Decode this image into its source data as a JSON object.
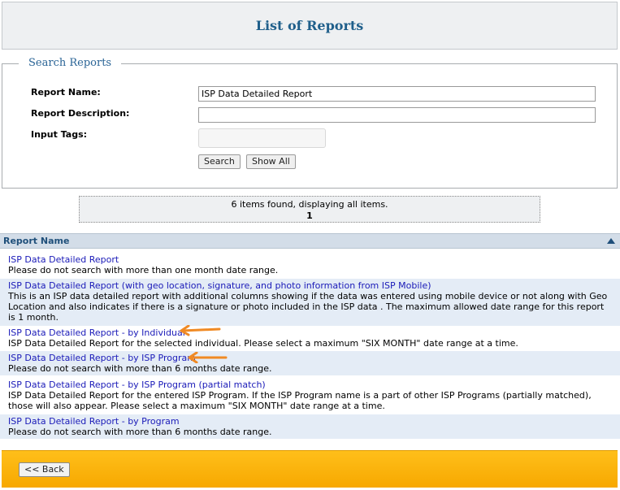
{
  "header": {
    "title": "List of Reports"
  },
  "search": {
    "legend": "Search Reports",
    "report_name_label": "Report Name:",
    "report_name_value": "ISP Data Detailed Report",
    "report_description_label": "Report Description:",
    "report_description_value": "",
    "input_tags_label": "Input Tags:",
    "search_button": "Search",
    "show_all_button": "Show All"
  },
  "pager": {
    "summary": "6 items found, displaying all items.",
    "page": "1"
  },
  "table": {
    "column_header": "Report Name",
    "rows": [
      {
        "title": "ISP Data Detailed Report",
        "description": "Please do not search with more than one month date range."
      },
      {
        "title": "ISP Data Detailed Report (with geo location, signature, and photo information from ISP Mobile)",
        "description": "This is an ISP data detailed report with additional columns showing if the data was entered using mobile device or not along with Geo Location and also indicates if there is a signature or photo included in the ISP data . The maximum allowed date range for this report is 1 month."
      },
      {
        "title": "ISP Data Detailed Report - by Individual",
        "description": "ISP Data Detailed Report for the selected individual. Please select a maximum \"SIX MONTH\" date range at a time."
      },
      {
        "title": "ISP Data Detailed Report - by ISP Program",
        "description": "Please do not search with more than 6 months date range."
      },
      {
        "title": "ISP Data Detailed Report - by ISP Program (partial match)",
        "description": "ISP Data Detailed Report for the entered ISP Program. If the ISP Program name is a part of other ISP Programs (partially matched), those will also appear. Please select a maximum \"SIX MONTH\" date range at a time."
      },
      {
        "title": "ISP Data Detailed Report - by Program",
        "description": "Please do not search with more than 6 months date range."
      }
    ]
  },
  "footer": {
    "back_button": "<< Back"
  },
  "colors": {
    "accent": "#1f5f8b",
    "link": "#1a1ab8",
    "footer": "#ffb300",
    "arrow": "#f08a24",
    "row_alt": "#e4ecf6"
  }
}
